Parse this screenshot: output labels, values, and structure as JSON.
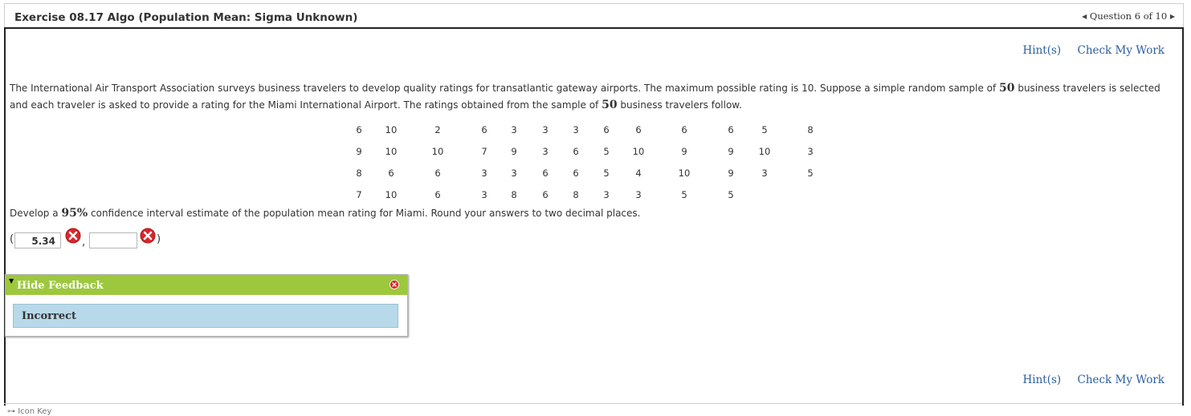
{
  "header": {
    "title": "Exercise 08.17 Algo (Population Mean: Sigma Unknown)",
    "nav_text": "Question 6 of 10"
  },
  "links": {
    "hints": "Hint(s)",
    "check": "Check My Work"
  },
  "question": {
    "part1": "The International Air Transport Association surveys business travelers to develop quality ratings for transatlantic gateway airports. The maximum possible rating is 10. Suppose a simple random sample of ",
    "n1": "50",
    "part2": " business travelers is selected and each traveler is asked to provide a rating for the Miami International Airport. The ratings obtained from the sample of ",
    "n2": "50",
    "part3": " business travelers follow."
  },
  "ratings": [
    [
      "6",
      "10",
      "2",
      "6",
      "3",
      "3",
      "3",
      "6",
      "6",
      "6",
      "6",
      "5",
      "8"
    ],
    [
      "9",
      "10",
      "10",
      "7",
      "9",
      "3",
      "6",
      "5",
      "10",
      "9",
      "9",
      "10",
      "3"
    ],
    [
      "8",
      "6",
      "6",
      "3",
      "3",
      "6",
      "6",
      "5",
      "4",
      "10",
      "9",
      "3",
      "5"
    ],
    [
      "7",
      "10",
      "6",
      "3",
      "8",
      "6",
      "8",
      "3",
      "3",
      "5",
      "5",
      "",
      ""
    ]
  ],
  "instruction": {
    "pre": "Develop a ",
    "conf": "95%",
    "post": " confidence interval estimate of the population mean rating for Miami. Round your answers to two decimal places."
  },
  "answer": {
    "open": "(",
    "lower": "5.34",
    "comma": ",",
    "upper": "",
    "close": ")"
  },
  "feedback": {
    "toggle_label": "Hide Feedback",
    "result": "Incorrect"
  },
  "footer": {
    "icon_key": "Icon Key"
  },
  "colors": {
    "link": "#2b5e9c",
    "feedback_header": "#9dc83e",
    "feedback_body": "#b7d9ea",
    "error": "#d9262c"
  }
}
